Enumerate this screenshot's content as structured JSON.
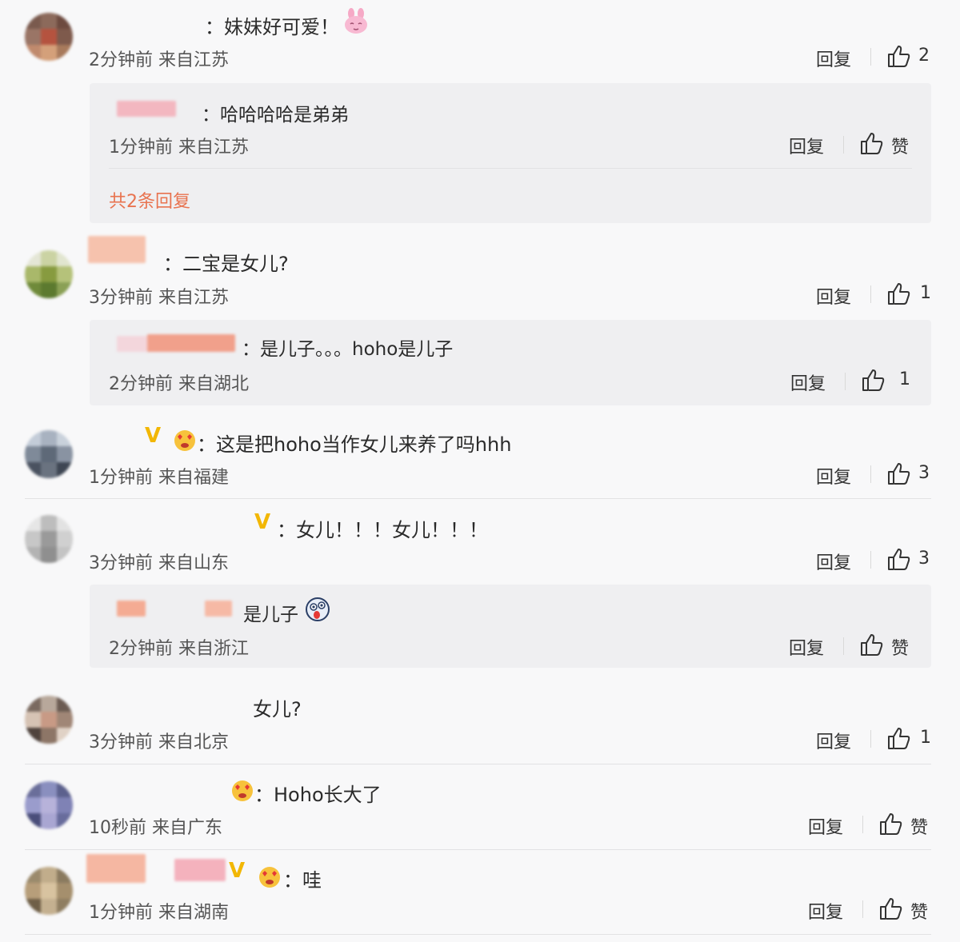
{
  "ui": {
    "reply_label": "回复",
    "like_label": "赞"
  },
  "comments": [
    {
      "text": "：妹妹好可爱！",
      "meta": "2分钟前 来自江苏",
      "likes": "2",
      "sub": {
        "text": "：哈哈哈哈是弟弟",
        "meta": "1分钟前 来自江苏",
        "likes": "赞",
        "more": "共2条回复"
      }
    },
    {
      "text": "：二宝是女儿?",
      "meta": "3分钟前 来自江苏",
      "likes": "1",
      "sub": {
        "text": "：是儿子。。。hoho是儿子",
        "meta": "2分钟前 来自湖北",
        "likes": "1"
      }
    },
    {
      "text": "：这是把hoho当作女儿来养了吗hhh",
      "meta": "1分钟前 来自福建",
      "likes": "3"
    },
    {
      "text": "：女儿！！！女儿！！！",
      "meta": "3分钟前 来自山东",
      "likes": "3",
      "sub": {
        "text": "是儿子",
        "meta": "2分钟前 来自浙江",
        "likes": "赞"
      }
    },
    {
      "text": "女儿?",
      "meta": "3分钟前 来自北京",
      "likes": "1"
    },
    {
      "text": "：Hoho长大了",
      "meta": "10秒前 来自广东",
      "likes": "赞"
    },
    {
      "text": "：哇",
      "meta": "1分钟前 来自湖南",
      "likes": "赞"
    }
  ]
}
